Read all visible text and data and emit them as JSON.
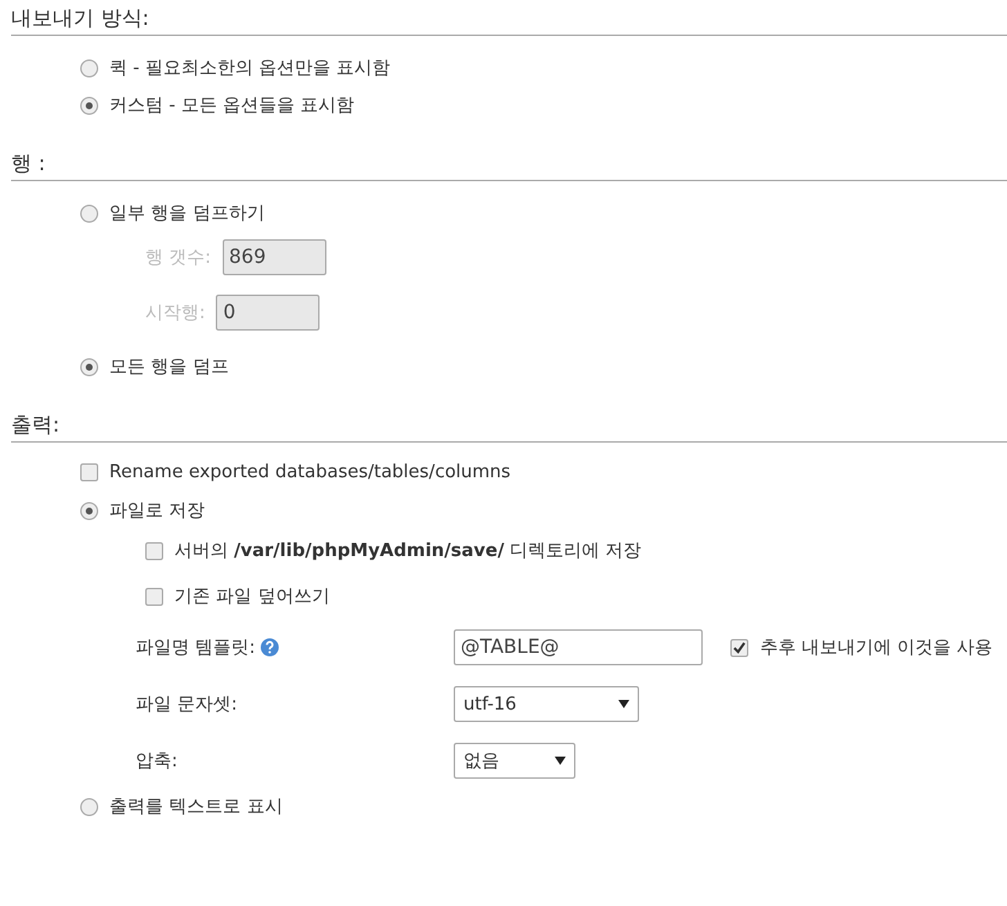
{
  "sections": [
    {
      "title": "내보내기 방식:",
      "items": [
        {
          "kind": "radio",
          "label": "퀵 - 필요최소한의 옵션만을 표시함",
          "selected": false
        },
        {
          "kind": "radio",
          "label": "커스텀 - 모든 옵션들을 표시함",
          "selected": true
        }
      ]
    },
    {
      "title": "행 :",
      "items": [
        {
          "kind": "radio",
          "label": "일부 행을 덤프하기",
          "selected": false,
          "children": [
            {
              "kind": "number",
              "label": "행 갯수:",
              "value": "869",
              "disabled": true
            },
            {
              "kind": "number",
              "label": "시작행:",
              "value": "0",
              "disabled": true
            }
          ]
        },
        {
          "kind": "radio",
          "label": "모든 행을 덤프",
          "selected": true
        }
      ]
    },
    {
      "title": "출력:",
      "items": [
        {
          "kind": "checkbox",
          "label": "Rename exported databases/tables/columns",
          "checked": false
        },
        {
          "kind": "radio",
          "label": "파일로 저장",
          "selected": true,
          "children": [
            {
              "kind": "checkbox",
              "label": "서버의 **/var/lib/phpMyAdmin/save/** 디렉토리에 저장",
              "checked": false
            },
            {
              "kind": "checkbox",
              "label": "기존 파일 덮어쓰기",
              "checked": false
            },
            {
              "kind": "text",
              "label": "파일명 템플릿:",
              "help": true,
              "value": "@TABLE@",
              "extra": {
                "label": "추후 내보내기에 이것을 사용",
                "checked": true
              }
            },
            {
              "kind": "select",
              "label": "파일 문자셋:",
              "value": "utf-16"
            },
            {
              "kind": "select",
              "label": "압축:",
              "value": "없음"
            }
          ]
        },
        {
          "kind": "radio",
          "label": "출력를 텍스트로 표시",
          "selected": false
        }
      ]
    }
  ]
}
